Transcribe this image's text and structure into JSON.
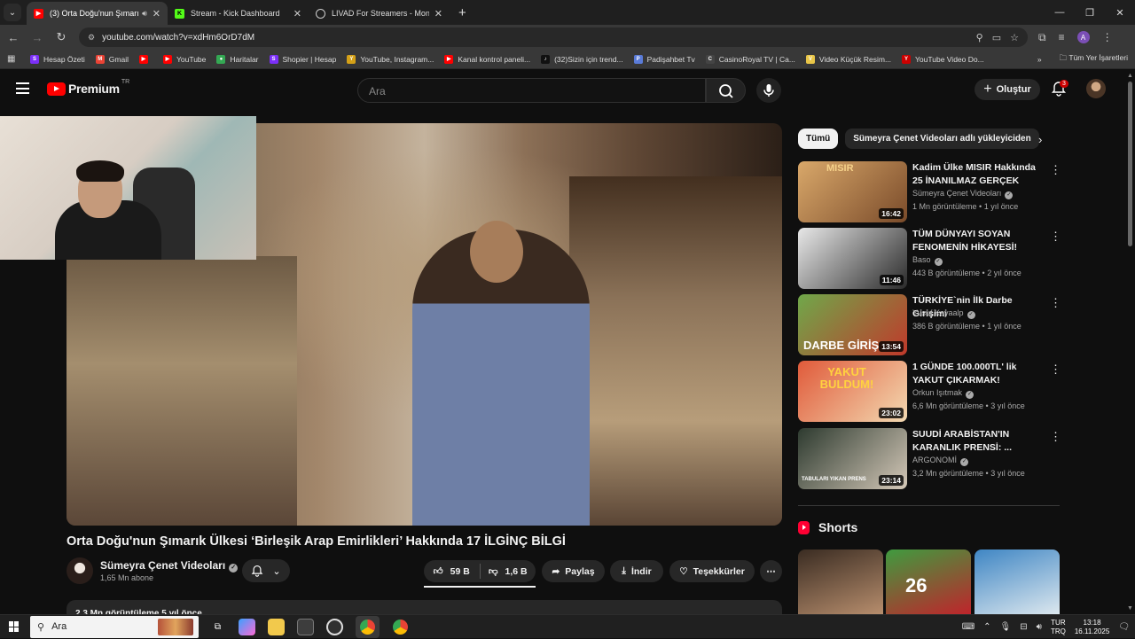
{
  "browser": {
    "tabs": [
      {
        "title": "(3) Orta Doğu'nun Şımarık Ü",
        "favicon_color": "#ff0000",
        "active": true,
        "audio": true
      },
      {
        "title": "Stream - Kick Dashboard",
        "favicon_color": "#53fc18",
        "favicon_letter": "K"
      },
      {
        "title": "LIVAD For Streamers - Monetiz",
        "favicon_color": "#dddddd"
      }
    ],
    "new_tab": "+",
    "url": "youtube.com/watch?v=xdHm6OrD7dM",
    "profile_letter": "A",
    "bookmarks": [
      {
        "label": "Hesap Özeti",
        "color": "#7b2ff7",
        "letter": "S"
      },
      {
        "label": "Gmail",
        "color": "#ea4335",
        "letter": "M"
      },
      {
        "label": "",
        "color": "#ff0000",
        "letter": "▶"
      },
      {
        "label": "YouTube",
        "color": "#ff0000",
        "letter": "▶"
      },
      {
        "label": "Haritalar",
        "color": "#34a853",
        "letter": "●"
      },
      {
        "label": "Shopier | Hesap",
        "color": "#7b2ff7",
        "letter": "S"
      },
      {
        "label": "YouTube, Instagram...",
        "color": "#d4a017",
        "letter": "Y"
      },
      {
        "label": "Kanal kontrol paneli...",
        "color": "#ff0000",
        "letter": "▶"
      },
      {
        "label": "(32)Sizin için trend...",
        "color": "#111111",
        "letter": "♪"
      },
      {
        "label": "Padişahbet Tv",
        "color": "#5a7bd8",
        "letter": "P"
      },
      {
        "label": "CasinoRoyal TV | Ca...",
        "color": "#444444",
        "letter": "C"
      },
      {
        "label": "Video Küçük Resim...",
        "color": "#e8c547",
        "letter": "V"
      },
      {
        "label": "YouTube Video Do...",
        "color": "#cc0000",
        "letter": "Y"
      }
    ],
    "all_bookmarks": "Tüm Yer İşaretleri"
  },
  "youtube": {
    "logo_text": "Premium",
    "logo_region": "TR",
    "search_placeholder": "Ara",
    "create_label": "Oluştur",
    "notification_count": "3",
    "video": {
      "title": "Orta Doğu'nun Şımarık Ülkesi ‘Birleşik Arap Emirlikleri’ Hakkında 17 İLGİNÇ BİLGİ",
      "channel": "Sümeyra Çenet Videoları",
      "subscribers": "1,65 Mn abone",
      "likes": "59 B",
      "dislikes": "1,6 B",
      "share_label": "Paylaş",
      "download_label": "İndir",
      "thanks_label": "Teşekkürler",
      "more": "⋯",
      "description_preview": "2,3 Mn görüntüleme  5 yıl önce"
    },
    "chips": [
      "Tümü",
      "Sümeyra Çenet Videoları adlı yükleyiciden"
    ],
    "recommendations": [
      {
        "title": "Kadim Ülke MISIR Hakkında 25 İNANILMAZ GERÇEK",
        "channel": "Sümeyra Çenet Videoları",
        "verified": true,
        "meta": "1 Mn görüntüleme • 1 yıl önce",
        "duration": "16:42",
        "thumb_text": "MISIR",
        "thumb_colors": [
          "#d9a86a",
          "#7a4b2a"
        ]
      },
      {
        "title": "TÜM DÜNYAYI SOYAN FENOMENİN HİKAYESİ!",
        "channel": "Baso",
        "verified": true,
        "meta": "443 B görüntüleme • 2 yıl önce",
        "duration": "11:46",
        "thumb_text": "",
        "thumb_colors": [
          "#e8e8e8",
          "#2b2b2b"
        ]
      },
      {
        "title": "TÜRKİYE`nin İlk Darbe Girişimi",
        "channel": "Yusuf Kayaalp",
        "verified": true,
        "meta": "386 B görüntüleme • 1 yıl önce",
        "duration": "13:54",
        "thumb_text": "DARBE GİRİŞ",
        "thumb_colors": [
          "#6fa84a",
          "#c0392b"
        ]
      },
      {
        "title": "1 GÜNDE 100.000TL' lik YAKUT ÇIKARMAK!",
        "channel": "Orkun Işıtmak",
        "verified": true,
        "meta": "6,6 Mn görüntüleme • 3 yıl önce",
        "duration": "23:02",
        "thumb_text": "YAKUT BULDUM!",
        "thumb_colors": [
          "#e05a3a",
          "#f3d9b1"
        ]
      },
      {
        "title": "SUUDİ ARABİSTAN'IN KARANLIK PRENSİ: ...",
        "channel": "ARGONOMİ",
        "verified": true,
        "meta": "3,2 Mn görüntüleme • 3 yıl önce",
        "duration": "23:14",
        "thumb_text": "TABULARI YIKAN PRENS",
        "thumb_colors": [
          "#2d3a2f",
          "#d4c8b8"
        ]
      }
    ],
    "shorts_title": "Shorts",
    "shorts": [
      {
        "colors": [
          "#3a2c22",
          "#b98f6e"
        ],
        "label": ""
      },
      {
        "colors": [
          "#3f9b3f",
          "#c2222b"
        ],
        "label": "26"
      },
      {
        "colors": [
          "#3f86c4",
          "#dfe9ef"
        ],
        "label": ""
      }
    ]
  },
  "taskbar": {
    "search_placeholder": "Ara",
    "lang_top": "TUR",
    "lang_bottom": "TRQ",
    "time": "13:18",
    "date": "16.11.2025"
  }
}
